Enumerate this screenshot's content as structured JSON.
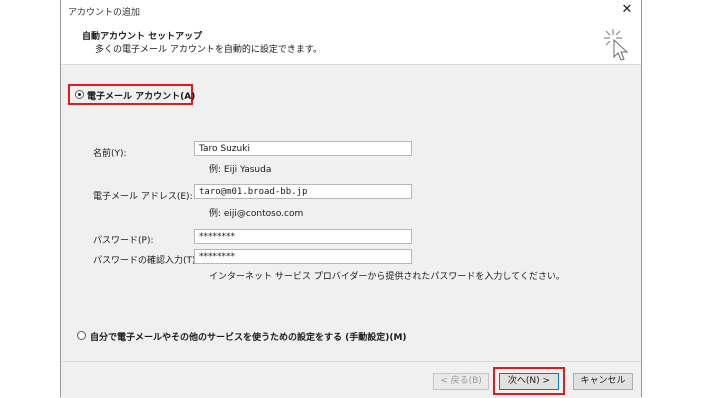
{
  "window": {
    "title": "アカウントの追加",
    "close_symbol": "✕"
  },
  "header": {
    "title": "自動アカウント セットアップ",
    "subtitle": "多くの電子メール アカウントを自動的に設定できます。",
    "icon": "cursor-sparkle-icon"
  },
  "options": {
    "email_account": {
      "label": "電子メール アカウント(A)",
      "selected": true
    },
    "manual_setup": {
      "label": "自分で電子メールやその他のサービスを使うための設定をする (手動設定)(M)",
      "selected": false
    }
  },
  "form": {
    "name": {
      "label": "名前(Y):",
      "value": "Taro Suzuki",
      "example": "例: Eiji Yasuda"
    },
    "email": {
      "label": "電子メール アドレス(E):",
      "value": "taro@m01.broad-bb.jp",
      "example": "例: eiji@contoso.com"
    },
    "password": {
      "label": "パスワード(P):",
      "value": "********"
    },
    "password_confirm": {
      "label": "パスワードの確認入力(T):",
      "value": "********"
    },
    "password_hint": "インターネット サービス プロバイダーから提供されたパスワードを入力してください。"
  },
  "footer": {
    "back_label": "< 戻る(B)",
    "next_label": "次へ(N) >",
    "cancel_label": "キャンセル"
  },
  "colors": {
    "highlight": "#e01b1b",
    "panel": "#f0f0f0",
    "primary_border": "#0078d7"
  }
}
